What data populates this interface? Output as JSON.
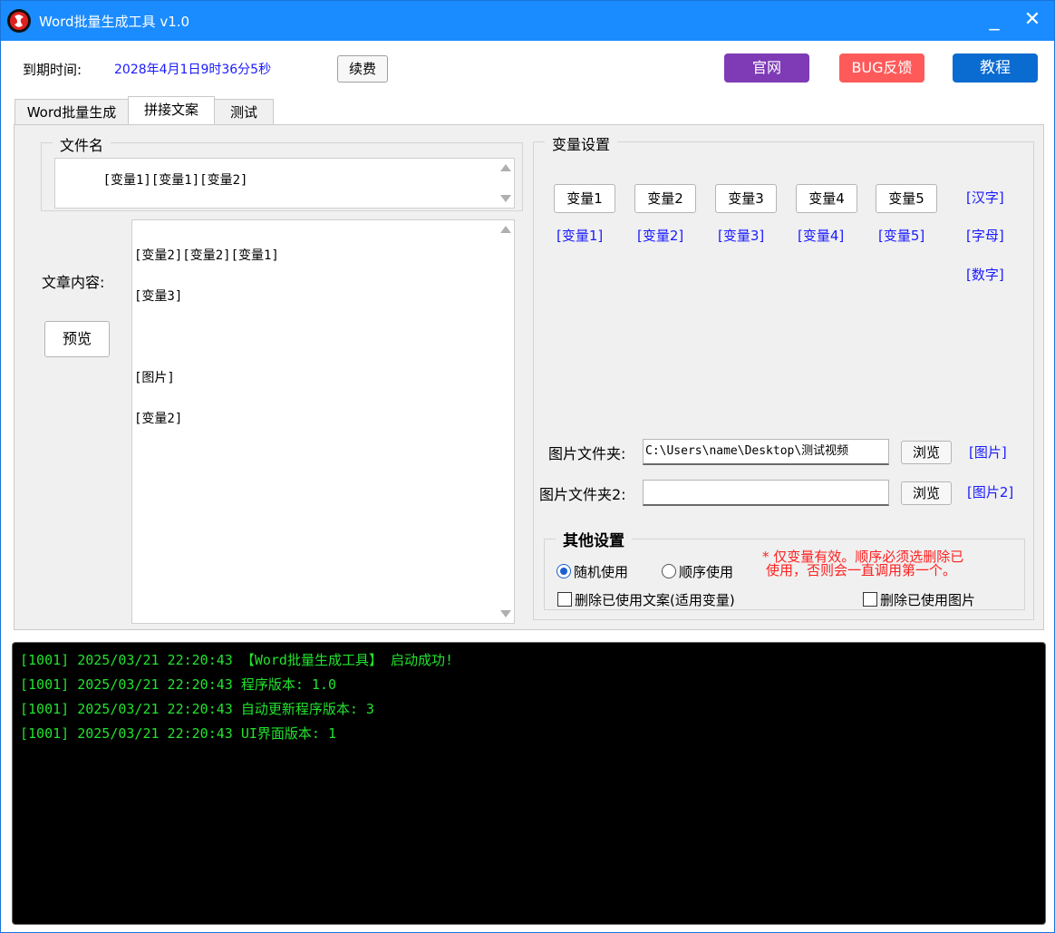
{
  "window": {
    "title": "Word批量生成工具  v1.0",
    "minimize_glyph": "_",
    "close_glyph": "✕"
  },
  "header": {
    "expire_label": "到期时间:",
    "expire_value": "2028年4月1日9时36分5秒",
    "renew_button": "续费",
    "official_button": "官网",
    "bug_button": "BUG反馈",
    "tutorial_button": "教程"
  },
  "tabs": [
    {
      "label": "Word批量生成"
    },
    {
      "label": "拼接文案"
    },
    {
      "label": "测试"
    }
  ],
  "active_tab": "拼接文案",
  "filename": {
    "group_title": "文件名",
    "value": "[变量1][变量1][变量2]"
  },
  "article": {
    "label": "文章内容:",
    "preview_button": "预览",
    "lines": [
      "[变量2][变量2][变量1]",
      "[变量3]",
      "",
      "[图片]",
      "[变量2]"
    ]
  },
  "variables": {
    "group_title": "变量设置",
    "buttons": [
      "变量1",
      "变量2",
      "变量3",
      "变量4",
      "变量5"
    ],
    "links": [
      "[变量1]",
      "[变量2]",
      "[变量3]",
      "[变量4]",
      "[变量5]"
    ],
    "type_links": [
      "[汉字]",
      "[字母]",
      "[数字]"
    ]
  },
  "images": {
    "folder1_label": "图片文件夹:",
    "folder1_value": "C:\\Users\\name\\Desktop\\测试视频",
    "folder1_browse": "浏览",
    "folder1_link": "[图片]",
    "folder2_label": "图片文件夹2:",
    "folder2_value": "",
    "folder2_browse": "浏览",
    "folder2_link": "[图片2]"
  },
  "other": {
    "group_title": "其他设置",
    "random_label": "随机使用",
    "sequential_label": "顺序使用",
    "selected": "随机使用",
    "warning_line1": "* 仅变量有效。顺序必须选删除已",
    "warning_line2": "使用，否则会一直调用第一个。",
    "delete_used_text_label": "删除已使用文案(适用变量)",
    "delete_used_text_checked": false,
    "delete_used_image_label": "删除已使用图片",
    "delete_used_image_checked": false
  },
  "log": {
    "lines": [
      "[1001] 2025/03/21 22:20:43 【Word批量生成工具】 启动成功!",
      "[1001] 2025/03/21 22:20:43 程序版本: 1.0",
      "[1001] 2025/03/21 22:20:43 自动更新程序版本: 3",
      "[1001] 2025/03/21 22:20:43 UI界面版本: 1"
    ]
  },
  "colors": {
    "titlebar": "#1a8cff",
    "official": "#7e3bb5",
    "bug": "#ff5a5a",
    "tutorial": "#0a6bd0",
    "link_blue": "#1a1aff",
    "warning_red": "#ff2020",
    "log_green": "#22e22e"
  }
}
